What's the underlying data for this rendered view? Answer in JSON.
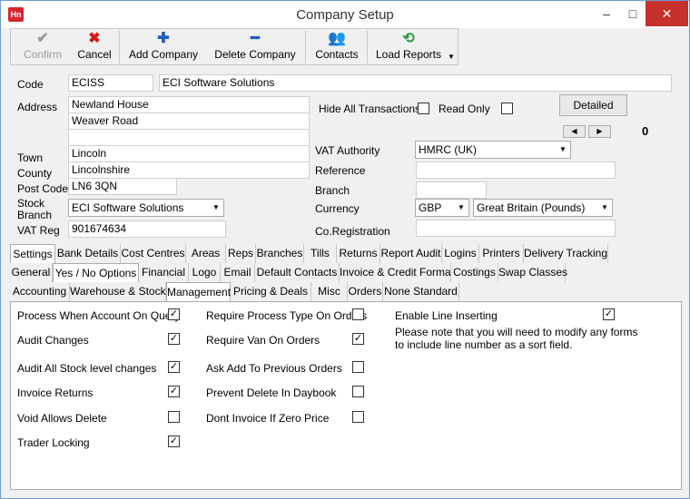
{
  "window": {
    "title": "Company Setup",
    "app_icon_text": "Hn",
    "minimize": "–",
    "maximize": "□",
    "close": "✕"
  },
  "toolbar": {
    "confirm": "Confirm",
    "cancel": "Cancel",
    "add_company": "Add Company",
    "delete_company": "Delete Company",
    "contacts": "Contacts",
    "load_reports": "Load Reports"
  },
  "form": {
    "code_label": "Code",
    "code": "ECISS",
    "name": "ECI Software Solutions",
    "address_label": "Address",
    "address1": "Newland House",
    "address2": "Weaver Road",
    "address3": "",
    "town_label": "Town",
    "town": "Lincoln",
    "county_label": "County",
    "county": "Lincolnshire",
    "postcode_label": "Post Code",
    "postcode": "LN6 3QN",
    "stock_branch_label": "Stock Branch",
    "stock_branch": "ECI Software Solutions",
    "vat_reg_label": "VAT Reg",
    "vat_reg": "901674634",
    "hide_all_label": "Hide All Transactions",
    "read_only_label": "Read Only",
    "detailed_label": "Detailed",
    "counter": "0",
    "vat_authority_label": "VAT Authority",
    "vat_authority": "HMRC (UK)",
    "reference_label": "Reference",
    "reference": "",
    "branch_label": "Branch",
    "branch": "",
    "currency_label": "Currency",
    "currency_code": "GBP",
    "currency_name": "Great Britain (Pounds)",
    "coreg_label": "Co.Registration",
    "coreg": ""
  },
  "tabs_row1": [
    "Settings",
    "Bank Details",
    "Cost Centres",
    "Areas",
    "Reps",
    "Branches",
    "Tills",
    "Returns",
    "Report Audit",
    "Logins",
    "Printers",
    "Delivery Tracking"
  ],
  "tabs_row2": [
    "General",
    "Yes / No Options",
    "Financial",
    "Logo",
    "Email",
    "Default Contacts",
    "Invoice & Credit Formats",
    "Costings",
    "Swap Classes"
  ],
  "tabs_row3": [
    "Accounting",
    "Warehouse & Stock",
    "Management",
    "Pricing & Deals",
    "Misc",
    "Orders",
    "None Standard"
  ],
  "options": {
    "col1": [
      {
        "label": "Process When Account On Query",
        "checked": true
      },
      {
        "label": "Audit Changes",
        "checked": true
      },
      {
        "label": "Audit All Stock level changes",
        "checked": true
      },
      {
        "label": "Invoice Returns",
        "checked": true
      },
      {
        "label": "Void Allows Delete",
        "checked": false
      },
      {
        "label": "Trader Locking",
        "checked": true
      }
    ],
    "col2": [
      {
        "label": "Require Process Type On Orders",
        "checked": false
      },
      {
        "label": "Require Van On Orders",
        "checked": true
      },
      {
        "label": "Ask Add To Previous Orders",
        "checked": false
      },
      {
        "label": "Prevent Delete In Daybook",
        "checked": false
      },
      {
        "label": "Dont Invoice If Zero Price",
        "checked": false
      }
    ],
    "enable_line_label": "Enable Line Inserting",
    "enable_line_checked": true,
    "note": "Please note that you will need to modify any forms to include line number as a sort field."
  }
}
